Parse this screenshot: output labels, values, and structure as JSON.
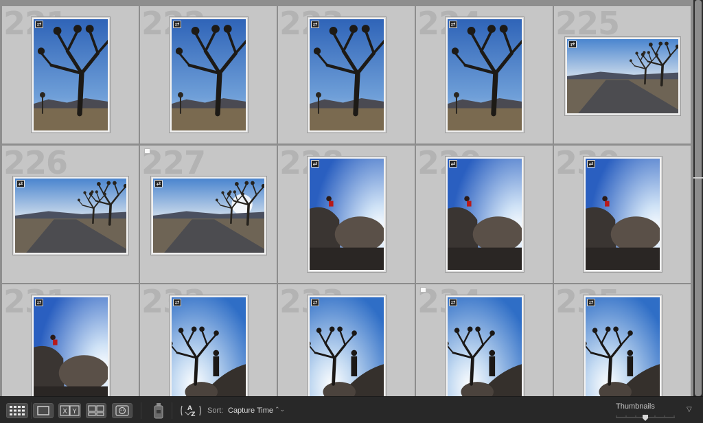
{
  "grid": {
    "cells": [
      {
        "number": "221",
        "photo": "tree-portrait",
        "flagged": false
      },
      {
        "number": "222",
        "photo": "tree-portrait",
        "flagged": false
      },
      {
        "number": "223",
        "photo": "tree-portrait",
        "flagged": false
      },
      {
        "number": "224",
        "photo": "tree-portrait",
        "flagged": false
      },
      {
        "number": "225",
        "photo": "road-landscape",
        "flagged": false
      },
      {
        "number": "226",
        "photo": "road-landscape",
        "flagged": false
      },
      {
        "number": "227",
        "photo": "road-landscape-sun",
        "flagged": true
      },
      {
        "number": "228",
        "photo": "rocks-portrait",
        "flagged": false
      },
      {
        "number": "229",
        "photo": "rocks-portrait",
        "flagged": false
      },
      {
        "number": "230",
        "photo": "rocks-portrait",
        "flagged": false
      },
      {
        "number": "231",
        "photo": "rocks-portrait",
        "flagged": false
      },
      {
        "number": "232",
        "photo": "silhouette-portrait",
        "flagged": false
      },
      {
        "number": "233",
        "photo": "silhouette-portrait",
        "flagged": false
      },
      {
        "number": "234",
        "photo": "silhouette-portrait",
        "flagged": true
      },
      {
        "number": "235",
        "photo": "silhouette-portrait",
        "flagged": false
      }
    ],
    "badge_icon": "develop-adjustments-icon"
  },
  "toolbar": {
    "view_buttons": [
      {
        "name": "grid-view-icon"
      },
      {
        "name": "loupe-view-icon"
      },
      {
        "name": "compare-view-icon"
      },
      {
        "name": "survey-view-icon"
      },
      {
        "name": "people-view-icon"
      }
    ],
    "spray_icon": "painter-spray-can-icon",
    "sort_direction_icon": "sort-az-icon",
    "sort_label": "Sort:",
    "sort_value": "Capture Time",
    "sort_chevron": "⌃⌄",
    "thumbnails_label": "Thumbnails",
    "thumbnail_size": 0.5,
    "menu_chevron": "▽"
  },
  "colors": {
    "cell_bg": "#c6c6c6",
    "grid_lines": "#8a8a8a",
    "toolbar_bg": "#282828",
    "sky": "#3a78c8"
  }
}
